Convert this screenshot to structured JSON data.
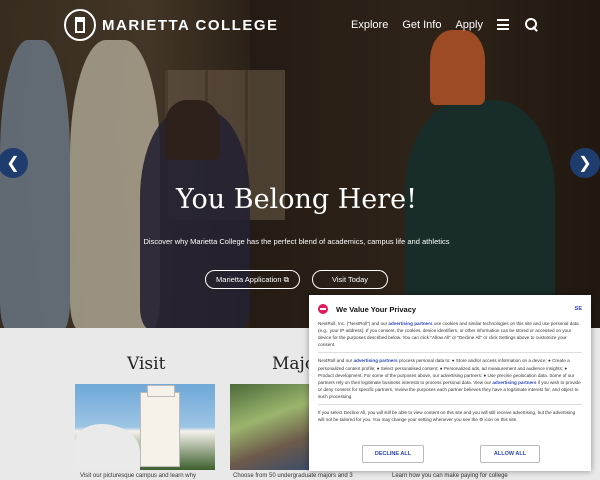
{
  "header": {
    "brand": "MARIETTA COLLEGE",
    "nav": [
      "Explore",
      "Get Info",
      "Apply"
    ]
  },
  "hero": {
    "title": "You Belong Here!",
    "subtitle": "Discover why Marietta College has the perfect blend of academics, campus life and athletics",
    "cta_application": "Marietta Application ⧉",
    "cta_visit": "Visit Today",
    "prev_arrow": "❮",
    "next_arrow": "❯"
  },
  "sections": {
    "visit_title": "Visit",
    "majors_title": "Majo",
    "visit_caption": "Visit our picturesque campus and learn why",
    "majors_caption": "Choose from 50 undergraduate majors and 3",
    "third_caption": "Learn how you can make paying for college"
  },
  "privacy_modal": {
    "title": "We Value Your Privacy",
    "language": "SE",
    "p1_a": "NextRoll, Inc. (\"NextRoll\") and our ",
    "p1_link": "advertising partners",
    "p1_b": " use cookies and similar technologies on this site and use personal data (e.g., your IP address). If you consent, the cookies, device identifiers, or other information can be stored or accessed on your device for the purposes described below. You can click \"Allow All\" or \"Decline All\" or click Settings above to customize your consent.",
    "p2_a": "NextRoll and our ",
    "p2_link": "advertising partners",
    "p2_b": " process personal data to: ● Store and/or access information on a device; ● Create a personalized content profile; ● Select personalised content; ● Personalized ads, ad measurement and audience insights; ● Product development. For some of the purposes above, our advertising partners: ● Use precise geolocation data. Some of our partners rely on their legitimate business interests to process personal data. View our ",
    "p2_link2": "advertising partners",
    "p2_c": " if you wish to provide or deny consent for specific partners, review the purposes each partner believes they have a legitimate interest for, and object to such processing.",
    "p3": "If you select Decline All, you will still be able to view content on this site and you will still receive advertising, but the advertising will not be tailored for you. You may change your setting whenever you see the ⚙ icon on this site.",
    "decline": "DECLINE ALL",
    "allow": "ALLOW ALL"
  },
  "colors": {
    "accent_blue": "#1f3c6e",
    "link_blue": "#2a46b8",
    "nextroll_pink": "#e21b5b"
  }
}
